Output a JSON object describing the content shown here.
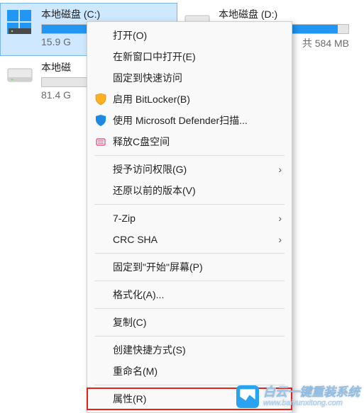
{
  "drives": [
    {
      "name": "本地磁盘 (C:)",
      "size_text": "15.9 G",
      "fill_pct": 94,
      "icon": "os",
      "selected": true
    },
    {
      "name": "本地磁盘 (D:)",
      "size_text": "共 584 MB",
      "fill_pct": 92,
      "icon": "disk",
      "selected": false
    },
    {
      "name": "本地磁",
      "size_text": "81.4 G",
      "fill_pct": 0,
      "icon": "disk",
      "selected": false
    }
  ],
  "menu": {
    "open": "打开(O)",
    "open_new_win": "在新窗口中打开(E)",
    "pin_quick": "固定到快速访问",
    "bitlocker": "启用 BitLocker(B)",
    "defender": "使用 Microsoft Defender扫描...",
    "free_c": "释放C盘空间",
    "grant_access": "授予访问权限(G)",
    "prev_versions": "还原以前的版本(V)",
    "seven_zip": "7-Zip",
    "crc_sha": "CRC SHA",
    "pin_start": "固定到\"开始\"屏幕(P)",
    "format": "格式化(A)...",
    "copy": "复制(C)",
    "shortcut": "创建快捷方式(S)",
    "rename": "重命名(M)",
    "properties": "属性(R)"
  },
  "watermark": {
    "title": "白云一键重装系统",
    "url": "www.baiyunxitong.com"
  }
}
